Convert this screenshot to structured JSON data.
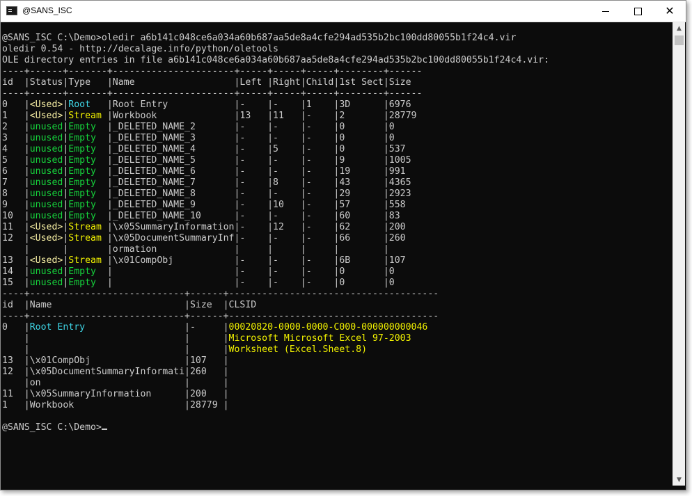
{
  "window": {
    "title": "@SANS_ISC",
    "icon": "console-icon",
    "controls": {
      "minimize": "minimize-icon",
      "maximize": "maximize-icon",
      "close": "✕"
    }
  },
  "colors": {
    "background": "#0c0c0c",
    "text": "#cccccc",
    "used": "#f9f1a5",
    "stream": "#f2f200",
    "root": "#3fd7e8",
    "unused": "#16d43c"
  },
  "console": {
    "lines": [
      [
        {
          "t": "@SANS_ISC C:\\Demo>oledir a6b141c048ce6a034a60b687aa5de8a4cfe294ad535b2bc100dd80055b1f24c4.vir",
          "c": "w"
        }
      ],
      [
        {
          "t": "oledir 0.54 - http://decalage.info/python/oletools",
          "c": "w"
        }
      ],
      [
        {
          "t": "OLE directory entries in file a6b141c048ce6a034a60b687aa5de8a4cfe294ad535b2bc100dd80055b1f24c4.vir:",
          "c": "w"
        }
      ],
      [
        {
          "t": "----+------+-------+----------------------+-----+-----+-----+--------+------",
          "c": "w"
        }
      ],
      [
        {
          "t": "id  |Status|Type   |Name                  |Left |Right|Child|1st Sect|Size",
          "c": "w"
        }
      ],
      [
        {
          "t": "----+------+-------+----------------------+-----+-----+-----+--------+------",
          "c": "w"
        }
      ],
      [
        {
          "t": "0   |",
          "c": "w"
        },
        {
          "t": "<Used>",
          "c": "y"
        },
        {
          "t": "|",
          "c": "w"
        },
        {
          "t": "Root   ",
          "c": "c"
        },
        {
          "t": "|Root Entry            |-    |-    |1    |3D      |6976",
          "c": "w"
        }
      ],
      [
        {
          "t": "1   |",
          "c": "w"
        },
        {
          "t": "<Used>",
          "c": "y"
        },
        {
          "t": "|",
          "c": "w"
        },
        {
          "t": "Stream ",
          "c": "Y"
        },
        {
          "t": "|Workbook              |13   |11   |-    |2       |28779",
          "c": "w"
        }
      ],
      [
        {
          "t": "2   |",
          "c": "w"
        },
        {
          "t": "unused",
          "c": "g"
        },
        {
          "t": "|",
          "c": "w"
        },
        {
          "t": "Empty  ",
          "c": "g"
        },
        {
          "t": "|_DELETED_NAME_2       |-    |-    |-    |0       |0",
          "c": "w"
        }
      ],
      [
        {
          "t": "3   |",
          "c": "w"
        },
        {
          "t": "unused",
          "c": "g"
        },
        {
          "t": "|",
          "c": "w"
        },
        {
          "t": "Empty  ",
          "c": "g"
        },
        {
          "t": "|_DELETED_NAME_3       |-    |-    |-    |0       |0",
          "c": "w"
        }
      ],
      [
        {
          "t": "4   |",
          "c": "w"
        },
        {
          "t": "unused",
          "c": "g"
        },
        {
          "t": "|",
          "c": "w"
        },
        {
          "t": "Empty  ",
          "c": "g"
        },
        {
          "t": "|_DELETED_NAME_4       |-    |5    |-    |0       |537",
          "c": "w"
        }
      ],
      [
        {
          "t": "5   |",
          "c": "w"
        },
        {
          "t": "unused",
          "c": "g"
        },
        {
          "t": "|",
          "c": "w"
        },
        {
          "t": "Empty  ",
          "c": "g"
        },
        {
          "t": "|_DELETED_NAME_5       |-    |-    |-    |9       |1005",
          "c": "w"
        }
      ],
      [
        {
          "t": "6   |",
          "c": "w"
        },
        {
          "t": "unused",
          "c": "g"
        },
        {
          "t": "|",
          "c": "w"
        },
        {
          "t": "Empty  ",
          "c": "g"
        },
        {
          "t": "|_DELETED_NAME_6       |-    |-    |-    |19      |991",
          "c": "w"
        }
      ],
      [
        {
          "t": "7   |",
          "c": "w"
        },
        {
          "t": "unused",
          "c": "g"
        },
        {
          "t": "|",
          "c": "w"
        },
        {
          "t": "Empty  ",
          "c": "g"
        },
        {
          "t": "|_DELETED_NAME_7       |-    |8    |-    |43      |4365",
          "c": "w"
        }
      ],
      [
        {
          "t": "8   |",
          "c": "w"
        },
        {
          "t": "unused",
          "c": "g"
        },
        {
          "t": "|",
          "c": "w"
        },
        {
          "t": "Empty  ",
          "c": "g"
        },
        {
          "t": "|_DELETED_NAME_8       |-    |-    |-    |29      |2923",
          "c": "w"
        }
      ],
      [
        {
          "t": "9   |",
          "c": "w"
        },
        {
          "t": "unused",
          "c": "g"
        },
        {
          "t": "|",
          "c": "w"
        },
        {
          "t": "Empty  ",
          "c": "g"
        },
        {
          "t": "|_DELETED_NAME_9       |-    |10   |-    |57      |558",
          "c": "w"
        }
      ],
      [
        {
          "t": "10  |",
          "c": "w"
        },
        {
          "t": "unused",
          "c": "g"
        },
        {
          "t": "|",
          "c": "w"
        },
        {
          "t": "Empty  ",
          "c": "g"
        },
        {
          "t": "|_DELETED_NAME_10      |-    |-    |-    |60      |83",
          "c": "w"
        }
      ],
      [
        {
          "t": "11  |",
          "c": "w"
        },
        {
          "t": "<Used>",
          "c": "y"
        },
        {
          "t": "|",
          "c": "w"
        },
        {
          "t": "Stream ",
          "c": "Y"
        },
        {
          "t": "|\\x05SummaryInformation|-    |12   |-    |62      |200",
          "c": "w"
        }
      ],
      [
        {
          "t": "12  |",
          "c": "w"
        },
        {
          "t": "<Used>",
          "c": "y"
        },
        {
          "t": "|",
          "c": "w"
        },
        {
          "t": "Stream ",
          "c": "Y"
        },
        {
          "t": "|\\x05DocumentSummaryInf|-    |-    |-    |66      |260",
          "c": "w"
        }
      ],
      [
        {
          "t": "    |      |       |ormation              |     |     |     |        |",
          "c": "w"
        }
      ],
      [
        {
          "t": "13  |",
          "c": "w"
        },
        {
          "t": "<Used>",
          "c": "y"
        },
        {
          "t": "|",
          "c": "w"
        },
        {
          "t": "Stream ",
          "c": "Y"
        },
        {
          "t": "|\\x01CompObj           |-    |-    |-    |6B      |107",
          "c": "w"
        }
      ],
      [
        {
          "t": "14  |",
          "c": "w"
        },
        {
          "t": "unused",
          "c": "g"
        },
        {
          "t": "|",
          "c": "w"
        },
        {
          "t": "Empty  ",
          "c": "g"
        },
        {
          "t": "|                      |-    |-    |-    |0       |0",
          "c": "w"
        }
      ],
      [
        {
          "t": "15  |",
          "c": "w"
        },
        {
          "t": "unused",
          "c": "g"
        },
        {
          "t": "|",
          "c": "w"
        },
        {
          "t": "Empty  ",
          "c": "g"
        },
        {
          "t": "|                      |-    |-    |-    |0       |0",
          "c": "w"
        }
      ],
      [
        {
          "t": "----+----------------------------+------+--------------------------------------",
          "c": "w"
        }
      ],
      [
        {
          "t": "id  |Name                        |Size  |CLSID",
          "c": "w"
        }
      ],
      [
        {
          "t": "----+----------------------------+------+--------------------------------------",
          "c": "w"
        }
      ],
      [
        {
          "t": "0   |",
          "c": "w"
        },
        {
          "t": "Root Entry",
          "c": "c"
        },
        {
          "t": "                  |-     |",
          "c": "w"
        },
        {
          "t": "00020820-0000-0000-C000-000000000046",
          "c": "Y"
        }
      ],
      [
        {
          "t": "    |                            |      |",
          "c": "w"
        },
        {
          "t": "Microsoft Microsoft Excel 97-2003",
          "c": "Y"
        }
      ],
      [
        {
          "t": "    |                            |      |",
          "c": "w"
        },
        {
          "t": "Worksheet (Excel.Sheet.8)",
          "c": "Y"
        }
      ],
      [
        {
          "t": "13  |\\x01CompObj                 |107   |",
          "c": "w"
        }
      ],
      [
        {
          "t": "12  |\\x05DocumentSummaryInformati|260   |",
          "c": "w"
        }
      ],
      [
        {
          "t": "    |on                          |      |",
          "c": "w"
        }
      ],
      [
        {
          "t": "11  |\\x05SummaryInformation      |200   |",
          "c": "w"
        }
      ],
      [
        {
          "t": "1   |Workbook                    |28779 |",
          "c": "w"
        }
      ],
      [
        {
          "t": "",
          "c": "w"
        }
      ],
      [
        {
          "t": "@SANS_ISC C:\\Demo>",
          "c": "w"
        }
      ]
    ]
  },
  "scrollbar": {
    "up": "▲",
    "down": "▼"
  }
}
